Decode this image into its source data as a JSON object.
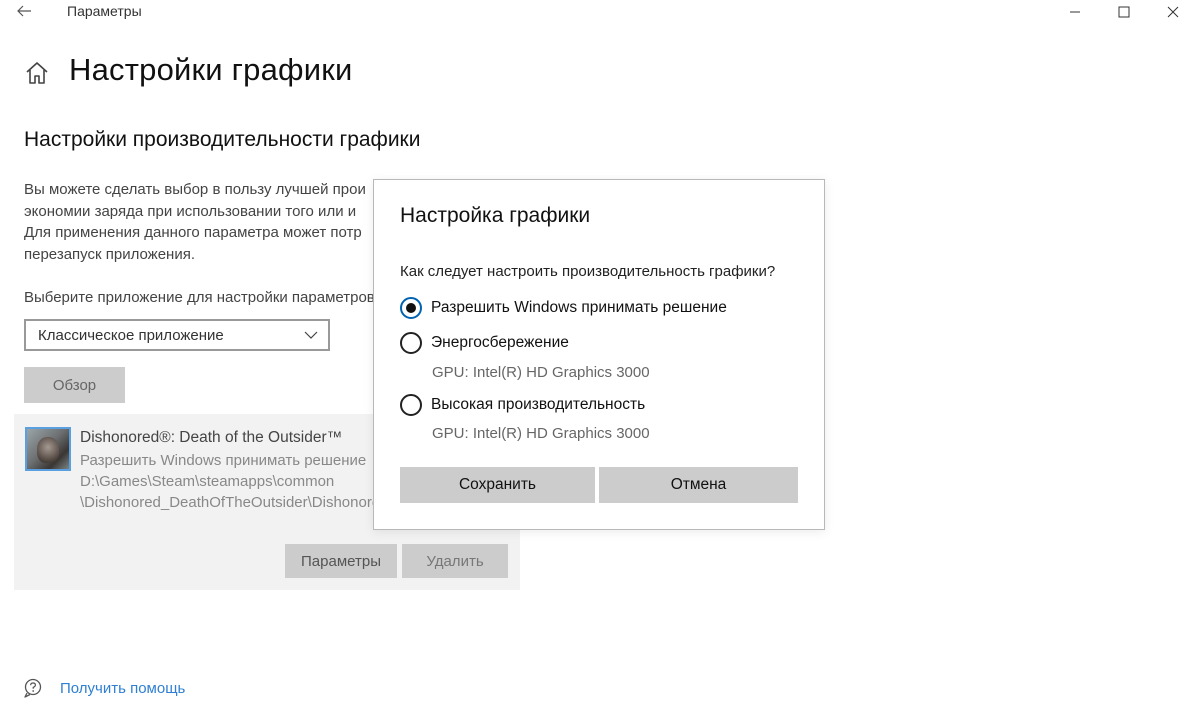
{
  "window": {
    "title": "Параметры"
  },
  "header": {
    "page_title": "Настройки графики"
  },
  "main": {
    "section_title": "Настройки производительности графики",
    "description": "Вы можете сделать выбор в пользу лучшей прои\nэкономии заряда при использовании того или и\nДля применения данного параметра может потр\nперезапуск приложения.",
    "choose_label": "Выберите приложение для настройки параметров",
    "app_type_select": {
      "value": "Классическое приложение"
    },
    "browse_label": "Обзор",
    "app_entry": {
      "name": "Dishonored®: Death of the Outsider™",
      "preference": "Разрешить Windows принимать решение",
      "path_line1": "D:\\Games\\Steam\\steamapps\\common",
      "path_line2": "\\Dishonored_DeathOfTheOutsider\\Dishonored",
      "options_label": "Параметры",
      "remove_label": "Удалить"
    }
  },
  "help": {
    "label": "Получить помощь"
  },
  "dialog": {
    "title": "Настройка графики",
    "question": "Как следует настроить производительность графики?",
    "options": [
      {
        "label": "Разрешить Windows принимать решение",
        "checked": true,
        "gpu": ""
      },
      {
        "label": "Энергосбережение",
        "checked": false,
        "gpu": "GPU: Intel(R) HD Graphics 3000"
      },
      {
        "label": "Высокая производительность",
        "checked": false,
        "gpu": "GPU: Intel(R) HD Graphics 3000"
      }
    ],
    "save_label": "Сохранить",
    "cancel_label": "Отмена"
  },
  "icons": {
    "back": "arrow-left-icon",
    "home": "home-icon",
    "chevron": "chevron-down-icon",
    "help": "chat-help-icon",
    "minimize": "minimize-icon",
    "maximize": "maximize-icon",
    "close": "close-icon"
  },
  "colors": {
    "accent": "#0063b1",
    "link": "#2f7fd2",
    "button_bg": "#cccccc",
    "card_bg": "#f2f2f2"
  }
}
